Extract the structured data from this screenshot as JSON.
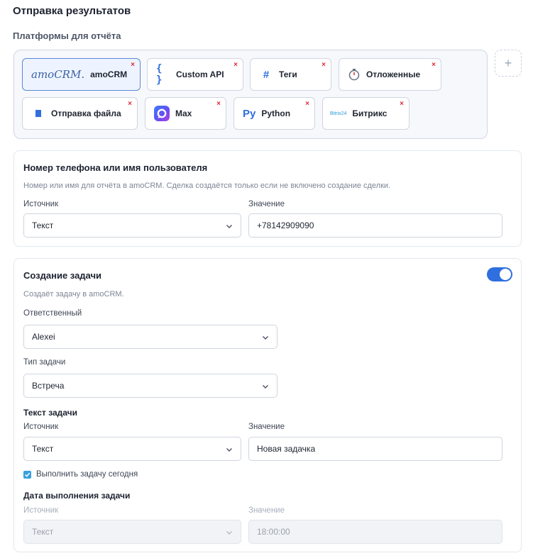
{
  "header": {
    "title": "Отправка результатов",
    "platforms_label": "Платформы для отчёта"
  },
  "platforms": [
    {
      "label": "amoCRM",
      "logo_text": "amoCRM.",
      "icon": "amocrm-logo",
      "active": true
    },
    {
      "label": "Custom API",
      "icon": "braces-icon"
    },
    {
      "label": "Теги",
      "icon": "hash-icon"
    },
    {
      "label": "Отложенные",
      "icon": "stopwatch-icon"
    },
    {
      "label": "Отправка файла",
      "icon": "file-icon"
    },
    {
      "label": "Max",
      "icon": "max-logo"
    },
    {
      "label": "Python",
      "logo_text": "Py",
      "icon": "python-icon"
    },
    {
      "label": "Битрикс",
      "logo_text": "Bitrix24",
      "icon": "bitrix-logo"
    }
  ],
  "add_platform": "+",
  "remove_mark": "×",
  "phone_card": {
    "title": "Номер телефона или имя пользователя",
    "hint": "Номер или имя для отчёта в amoCRM. Сделка создаётся только если не включено создание сделки.",
    "source_label": "Источник",
    "source_value": "Текст",
    "value_label": "Значение",
    "value": "+78142909090"
  },
  "task_card": {
    "title": "Создание задачи",
    "hint": "Создаёт задачу в amoCRM.",
    "enabled": true,
    "responsible_label": "Ответственный",
    "responsible_value": "Alexei",
    "type_label": "Тип задачи",
    "type_value": "Встреча",
    "text_section": "Текст задачи",
    "text_source_label": "Источник",
    "text_source_value": "Текст",
    "text_value_label": "Значение",
    "text_value": "Новая задачка",
    "today_checkbox_label": "Выполнить задачу сегодня",
    "today_checked": true,
    "date_section": "Дата выполнения задачи",
    "date_source_label": "Источник",
    "date_source_value": "Текст",
    "date_value_label": "Значение",
    "date_value": "18:00:00"
  },
  "colors": {
    "accent": "#2f6fdf",
    "remove": "#e0293a",
    "checkbox": "#37a0e0"
  }
}
